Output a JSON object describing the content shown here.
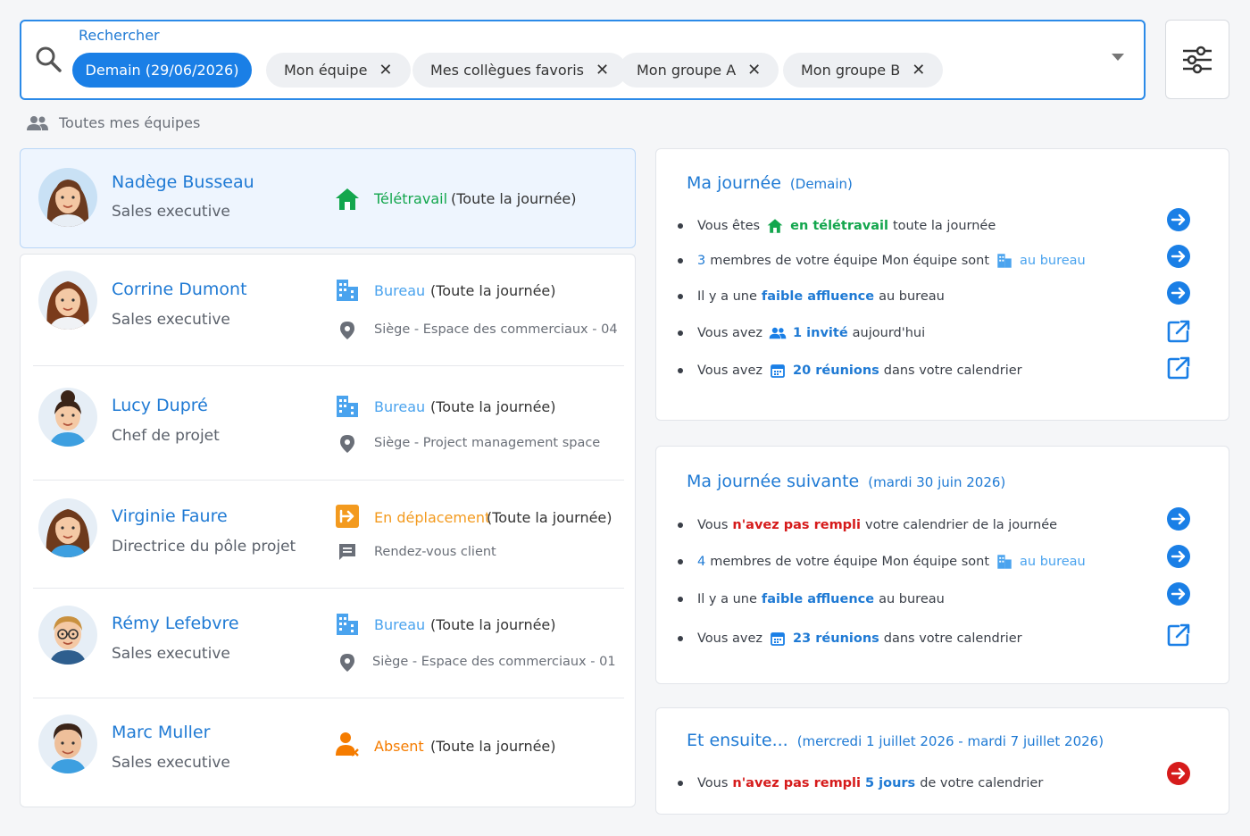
{
  "search": {
    "label": "Rechercher",
    "chips": [
      {
        "label": "Demain (29/06/2026)",
        "active": true
      },
      {
        "label": "Mon équipe",
        "removable": true
      },
      {
        "label": "Mes collègues favoris",
        "removable": true
      },
      {
        "label": "Mon groupe A",
        "removable": true
      },
      {
        "label": "Mon groupe B",
        "removable": true
      }
    ],
    "remove_glyph": "✕"
  },
  "section": {
    "label": "Toutes mes équipes"
  },
  "members": [
    {
      "name": "Nadège Busseau",
      "role": "Sales executive",
      "status": "Télétravail",
      "status_color": "#13a64d",
      "duration": "(Toute la journée)",
      "status_icon": "home-icon"
    },
    {
      "name": "Corrine Dumont",
      "role": "Sales executive",
      "status": "Bureau",
      "status_color": "#4aa3ee",
      "duration": "(Toute la journée)",
      "detail": "Siège - Espace des commerciaux - 04",
      "detail_icon": "location-pin-icon",
      "status_icon": "building-icon"
    },
    {
      "name": "Lucy Dupré",
      "role": "Chef de projet",
      "status": "Bureau",
      "status_color": "#4aa3ee",
      "duration": "(Toute la journée)",
      "detail": "Siège - Project management space",
      "detail_icon": "location-pin-icon",
      "status_icon": "building-icon"
    },
    {
      "name": "Virginie Faure",
      "role": "Directrice du pôle projet",
      "status": "En déplacement",
      "status_color": "#f39a1e",
      "duration": "(Toute la journée)",
      "detail": "Rendez-vous client",
      "detail_icon": "comment-icon",
      "status_icon": "travel-icon"
    },
    {
      "name": "Rémy Lefebvre",
      "role": "Sales executive",
      "status": "Bureau",
      "status_color": "#4aa3ee",
      "duration": "(Toute la journée)",
      "detail": "Siège - Espace des commerciaux - 01",
      "detail_icon": "location-pin-icon",
      "status_icon": "building-icon"
    },
    {
      "name": "Marc Muller",
      "role": "Sales executive",
      "status": "Absent",
      "status_color": "#f57c00",
      "duration": "(Toute la journée)",
      "status_icon": "absent-icon"
    }
  ],
  "day_card": {
    "title": "Ma journée",
    "subtitle": "(Demain)",
    "rows": {
      "r1": {
        "a": "Vous êtes",
        "b": "en télétravail",
        "c": "toute la journée"
      },
      "r2": {
        "a": "3",
        "b": "membres de votre équipe Mon équipe sont",
        "c": "au bureau"
      },
      "r3": {
        "a": "Il y a une",
        "b": "faible affluence",
        "c": "au bureau"
      },
      "r4": {
        "a": "Vous avez",
        "b": "1 invité",
        "c": "aujourd'hui"
      },
      "r5": {
        "a": "Vous avez",
        "b": "20 réunions",
        "c": "dans votre calendrier"
      }
    }
  },
  "next_card": {
    "title": "Ma journée suivante",
    "subtitle": "(mardi 30 juin 2026)",
    "rows": {
      "r1": {
        "a": "Vous",
        "b": "n'avez pas rempli",
        "c": "votre calendrier de la journée"
      },
      "r2": {
        "a": "4",
        "b": "membres de votre équipe Mon équipe sont",
        "c": "au bureau"
      },
      "r3": {
        "a": "Il y a une",
        "b": "faible affluence",
        "c": "au bureau"
      },
      "r4": {
        "a": "Vous avez",
        "b": "23 réunions",
        "c": "dans votre calendrier"
      }
    }
  },
  "then_card": {
    "title": "Et ensuite...",
    "subtitle": "(mercredi 1 juillet 2026 - mardi 7 juillet 2026)",
    "rows": {
      "r1": {
        "a": "Vous",
        "b": "n'avez pas rempli",
        "c": "5 jours",
        "d": "de votre calendrier"
      }
    }
  },
  "colors": {
    "accent": "#1a7fe6",
    "green": "#13a64d",
    "orange": "#f39a1e",
    "red": "#d61b1b"
  }
}
